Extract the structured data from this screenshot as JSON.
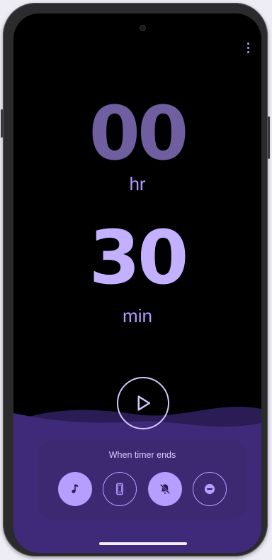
{
  "timer": {
    "hours": "00",
    "hours_unit": "hr",
    "minutes": "30",
    "minutes_unit": "min"
  },
  "controls": {
    "play_icon": "play-icon",
    "menu_icon": "more-vert-icon"
  },
  "alert_options": {
    "title": "When timer ends",
    "options": [
      {
        "icon": "music-note-icon",
        "selected": true
      },
      {
        "icon": "vibrate-phone-icon",
        "selected": false
      },
      {
        "icon": "bell-off-icon",
        "selected": true
      },
      {
        "icon": "do-not-disturb-icon",
        "selected": false
      }
    ]
  },
  "colors": {
    "accent": "#b59eff",
    "hours_digits": "#6f5fa0",
    "minutes_digits": "#c3b0ff",
    "wave": "#3e2a78",
    "background": "#000000"
  }
}
